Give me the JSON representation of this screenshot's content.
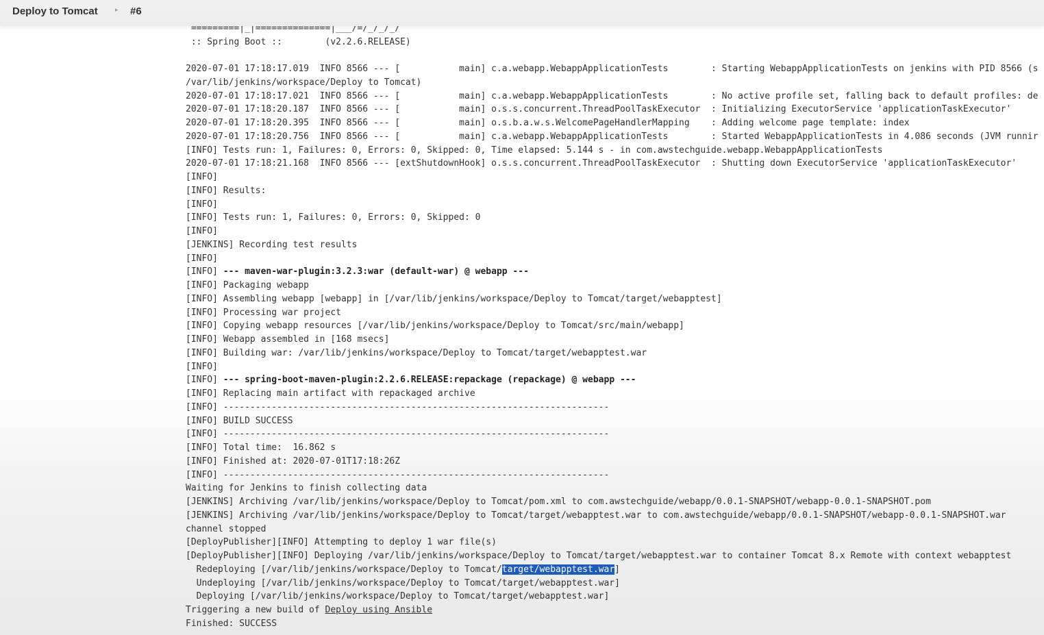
{
  "breadcrumb": {
    "job": "Deploy to Tomcat",
    "separator": "▸",
    "build": "#6"
  },
  "console": {
    "banner_1": " =========|_|==============|___/=/_/_/_/",
    "banner_2": " :: Spring Boot ::        (v2.2.6.RELEASE)",
    "l1": "2020-07-01 17:18:17.019  INFO 8566 --- [           main] c.a.webapp.WebappApplicationTests        : Starting WebappApplicationTests on jenkins with PID 8566 (s",
    "l2": "/var/lib/jenkins/workspace/Deploy to Tomcat)",
    "l3": "2020-07-01 17:18:17.021  INFO 8566 --- [           main] c.a.webapp.WebappApplicationTests        : No active profile set, falling back to default profiles: de",
    "l4": "2020-07-01 17:18:20.187  INFO 8566 --- [           main] o.s.s.concurrent.ThreadPoolTaskExecutor  : Initializing ExecutorService 'applicationTaskExecutor'",
    "l5": "2020-07-01 17:18:20.395  INFO 8566 --- [           main] o.s.b.a.w.s.WelcomePageHandlerMapping    : Adding welcome page template: index",
    "l6": "2020-07-01 17:18:20.756  INFO 8566 --- [           main] c.a.webapp.WebappApplicationTests        : Started WebappApplicationTests in 4.086 seconds (JVM runnir",
    "l7": "[INFO] Tests run: 1, Failures: 0, Errors: 0, Skipped: 0, Time elapsed: 5.144 s - in com.awstechguide.webapp.WebappApplicationTests",
    "l8": "2020-07-01 17:18:21.168  INFO 8566 --- [extShutdownHook] o.s.s.concurrent.ThreadPoolTaskExecutor  : Shutting down ExecutorService 'applicationTaskExecutor'",
    "l9": "[INFO]",
    "l10": "[INFO] Results:",
    "l11": "[INFO]",
    "l12": "[INFO] Tests run: 1, Failures: 0, Errors: 0, Skipped: 0",
    "l13": "[INFO]",
    "l14": "[JENKINS] Recording test results",
    "l15": "[INFO]",
    "l16_prefix": "[INFO] ",
    "l16_bold": "--- maven-war-plugin:3.2.3:war (default-war) @ webapp ---",
    "l17": "[INFO] Packaging webapp",
    "l18": "[INFO] Assembling webapp [webapp] in [/var/lib/jenkins/workspace/Deploy to Tomcat/target/webapptest]",
    "l19": "[INFO] Processing war project",
    "l20": "[INFO] Copying webapp resources [/var/lib/jenkins/workspace/Deploy to Tomcat/src/main/webapp]",
    "l21": "[INFO] Webapp assembled in [168 msecs]",
    "l22": "[INFO] Building war: /var/lib/jenkins/workspace/Deploy to Tomcat/target/webapptest.war",
    "l23": "[INFO]",
    "l24_prefix": "[INFO] ",
    "l24_bold": "--- spring-boot-maven-plugin:2.2.6.RELEASE:repackage (repackage) @ webapp ---",
    "l25": "[INFO] Replacing main artifact with repackaged archive",
    "l26": "[INFO] ------------------------------------------------------------------------",
    "l27": "[INFO] BUILD SUCCESS",
    "l28": "[INFO] ------------------------------------------------------------------------",
    "l29": "[INFO] Total time:  16.862 s",
    "l30": "[INFO] Finished at: 2020-07-01T17:18:26Z",
    "l31": "[INFO] ------------------------------------------------------------------------",
    "l32": "Waiting for Jenkins to finish collecting data",
    "l33": "[JENKINS] Archiving /var/lib/jenkins/workspace/Deploy to Tomcat/pom.xml to com.awstechguide/webapp/0.0.1-SNAPSHOT/webapp-0.0.1-SNAPSHOT.pom",
    "l34": "[JENKINS] Archiving /var/lib/jenkins/workspace/Deploy to Tomcat/target/webapptest.war to com.awstechguide/webapp/0.0.1-SNAPSHOT/webapp-0.0.1-SNAPSHOT.war",
    "l35": "channel stopped",
    "l36": "[DeployPublisher][INFO] Attempting to deploy 1 war file(s)",
    "l37": "[DeployPublisher][INFO] Deploying /var/lib/jenkins/workspace/Deploy to Tomcat/target/webapptest.war to container Tomcat 8.x Remote with context webapptest",
    "l38_prefix": "  Redeploying [/var/lib/jenkins/workspace/Deploy to Tomcat/",
    "l38_highlight": "target/webapptest.war",
    "l38_suffix": "]",
    "l39": "  Undeploying [/var/lib/jenkins/workspace/Deploy to Tomcat/target/webapptest.war]",
    "l40": "  Deploying [/var/lib/jenkins/workspace/Deploy to Tomcat/target/webapptest.war]",
    "l41_prefix": "Triggering a new build of ",
    "l41_link": "Deploy using Ansible",
    "l42": "Finished: SUCCESS"
  }
}
